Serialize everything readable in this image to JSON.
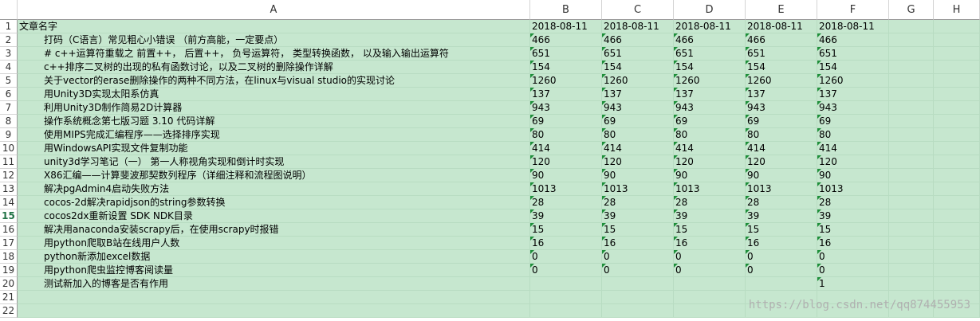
{
  "columns": [
    "A",
    "B",
    "C",
    "D",
    "E",
    "F",
    "G",
    "H"
  ],
  "selected_row": 15,
  "rows": [
    {
      "num": "1",
      "a": "文章名字",
      "vals": [
        "2018-08-11",
        "2018-08-11",
        "2018-08-11",
        "2018-08-11",
        "2018-08-11"
      ],
      "header": true
    },
    {
      "num": "2",
      "a": "打码（C语言）常见粗心小错误 （前方高能，一定要点）",
      "vals": [
        "466",
        "466",
        "466",
        "466",
        "466"
      ]
    },
    {
      "num": "3",
      "a": "# c++运算符重载之 前置++， 后置++， 负号运算符， 类型转换函数， 以及输入输出运算符",
      "vals": [
        "651",
        "651",
        "651",
        "651",
        "651"
      ]
    },
    {
      "num": "4",
      "a": "c++排序二叉树的出现的私有函数讨论，以及二叉树的删除操作详解",
      "vals": [
        "154",
        "154",
        "154",
        "154",
        "154"
      ]
    },
    {
      "num": "5",
      "a": "关于vector的erase删除操作的两种不同方法，在linux与visual studio的实现讨论",
      "vals": [
        "1260",
        "1260",
        "1260",
        "1260",
        "1260"
      ]
    },
    {
      "num": "6",
      "a": "用Unity3D实现太阳系仿真",
      "vals": [
        "137",
        "137",
        "137",
        "137",
        "137"
      ]
    },
    {
      "num": "7",
      "a": "利用Unity3D制作简易2D计算器",
      "vals": [
        "943",
        "943",
        "943",
        "943",
        "943"
      ]
    },
    {
      "num": "8",
      "a": "操作系统概念第七版习题 3.10 代码详解",
      "vals": [
        "69",
        "69",
        "69",
        "69",
        "69"
      ]
    },
    {
      "num": "9",
      "a": "使用MIPS完成汇编程序——选择排序实现",
      "vals": [
        "80",
        "80",
        "80",
        "80",
        "80"
      ]
    },
    {
      "num": "10",
      "a": "用WindowsAPI实现文件复制功能",
      "vals": [
        "414",
        "414",
        "414",
        "414",
        "414"
      ]
    },
    {
      "num": "11",
      "a": "unity3d学习笔记（一） 第一人称视角实现和倒计时实现",
      "vals": [
        "120",
        "120",
        "120",
        "120",
        "120"
      ]
    },
    {
      "num": "12",
      "a": "X86汇编——计算斐波那契数列程序（详细注释和流程图说明）",
      "vals": [
        "90",
        "90",
        "90",
        "90",
        "90"
      ]
    },
    {
      "num": "13",
      "a": "解决pgAdmin4启动失败方法",
      "vals": [
        "1013",
        "1013",
        "1013",
        "1013",
        "1013"
      ]
    },
    {
      "num": "14",
      "a": "cocos-2d解决rapidjson的string参数转换",
      "vals": [
        "28",
        "28",
        "28",
        "28",
        "28"
      ]
    },
    {
      "num": "15",
      "a": "cocos2dx重新设置 SDK NDK目录",
      "vals": [
        "39",
        "39",
        "39",
        "39",
        "39"
      ]
    },
    {
      "num": "16",
      "a": "解决用anaconda安装scrapy后，在使用scrapy时报错",
      "vals": [
        "15",
        "15",
        "15",
        "15",
        "15"
      ]
    },
    {
      "num": "17",
      "a": "用python爬取B站在线用户人数",
      "vals": [
        "16",
        "16",
        "16",
        "16",
        "16"
      ]
    },
    {
      "num": "18",
      "a": "python新添加excel数据",
      "vals": [
        "0",
        "0",
        "0",
        "0",
        "0"
      ]
    },
    {
      "num": "19",
      "a": "用python爬虫监控博客阅读量",
      "vals": [
        "0",
        "0",
        "0",
        "0",
        "0"
      ]
    },
    {
      "num": "20",
      "a": "测试新加入的博客是否有作用",
      "vals": [
        "",
        "",
        "",
        "",
        "1"
      ]
    },
    {
      "num": "21",
      "a": "",
      "vals": [
        "",
        "",
        "",
        "",
        ""
      ]
    },
    {
      "num": "22",
      "a": "",
      "vals": [
        "",
        "",
        "",
        "",
        ""
      ]
    }
  ],
  "watermark": "https://blog.csdn.net/qq874455953"
}
